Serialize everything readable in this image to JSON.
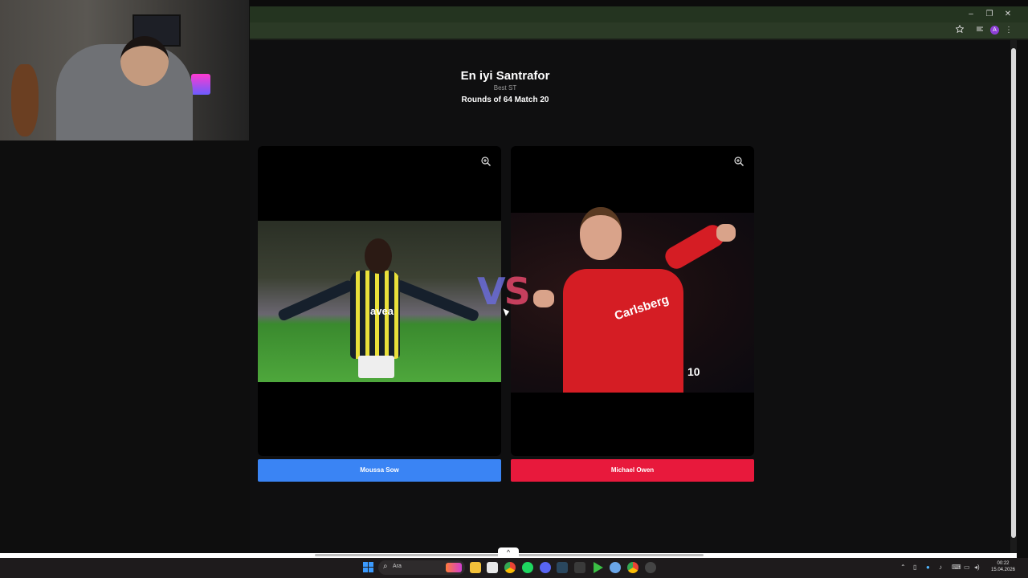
{
  "window": {
    "minimize_glyph": "–",
    "maximize_glyph": "❐",
    "close_glyph": "✕"
  },
  "toolbar": {
    "bookmark_icon": "star-icon",
    "extensions_icon": "extensions-icon",
    "profile_initial": "A",
    "menu_glyph": "⋮"
  },
  "header": {
    "title": "En iyi Santrafor",
    "subtitle": "Best ST",
    "round_info": "Rounds of 64 Match 20"
  },
  "matchup": {
    "vs_left": "V",
    "vs_right": "S",
    "left": {
      "name": "Moussa Sow",
      "color": "#3a84f4",
      "sponsor": "avea"
    },
    "right": {
      "name": "Michael Owen",
      "color": "#e8193c",
      "sponsor": "Carlsberg",
      "number": "10"
    }
  },
  "scroll": {
    "up_glyph": "^"
  },
  "taskbar": {
    "search_placeholder": "Ara",
    "clock_time": "00:22",
    "clock_date": "15.04.2026"
  }
}
